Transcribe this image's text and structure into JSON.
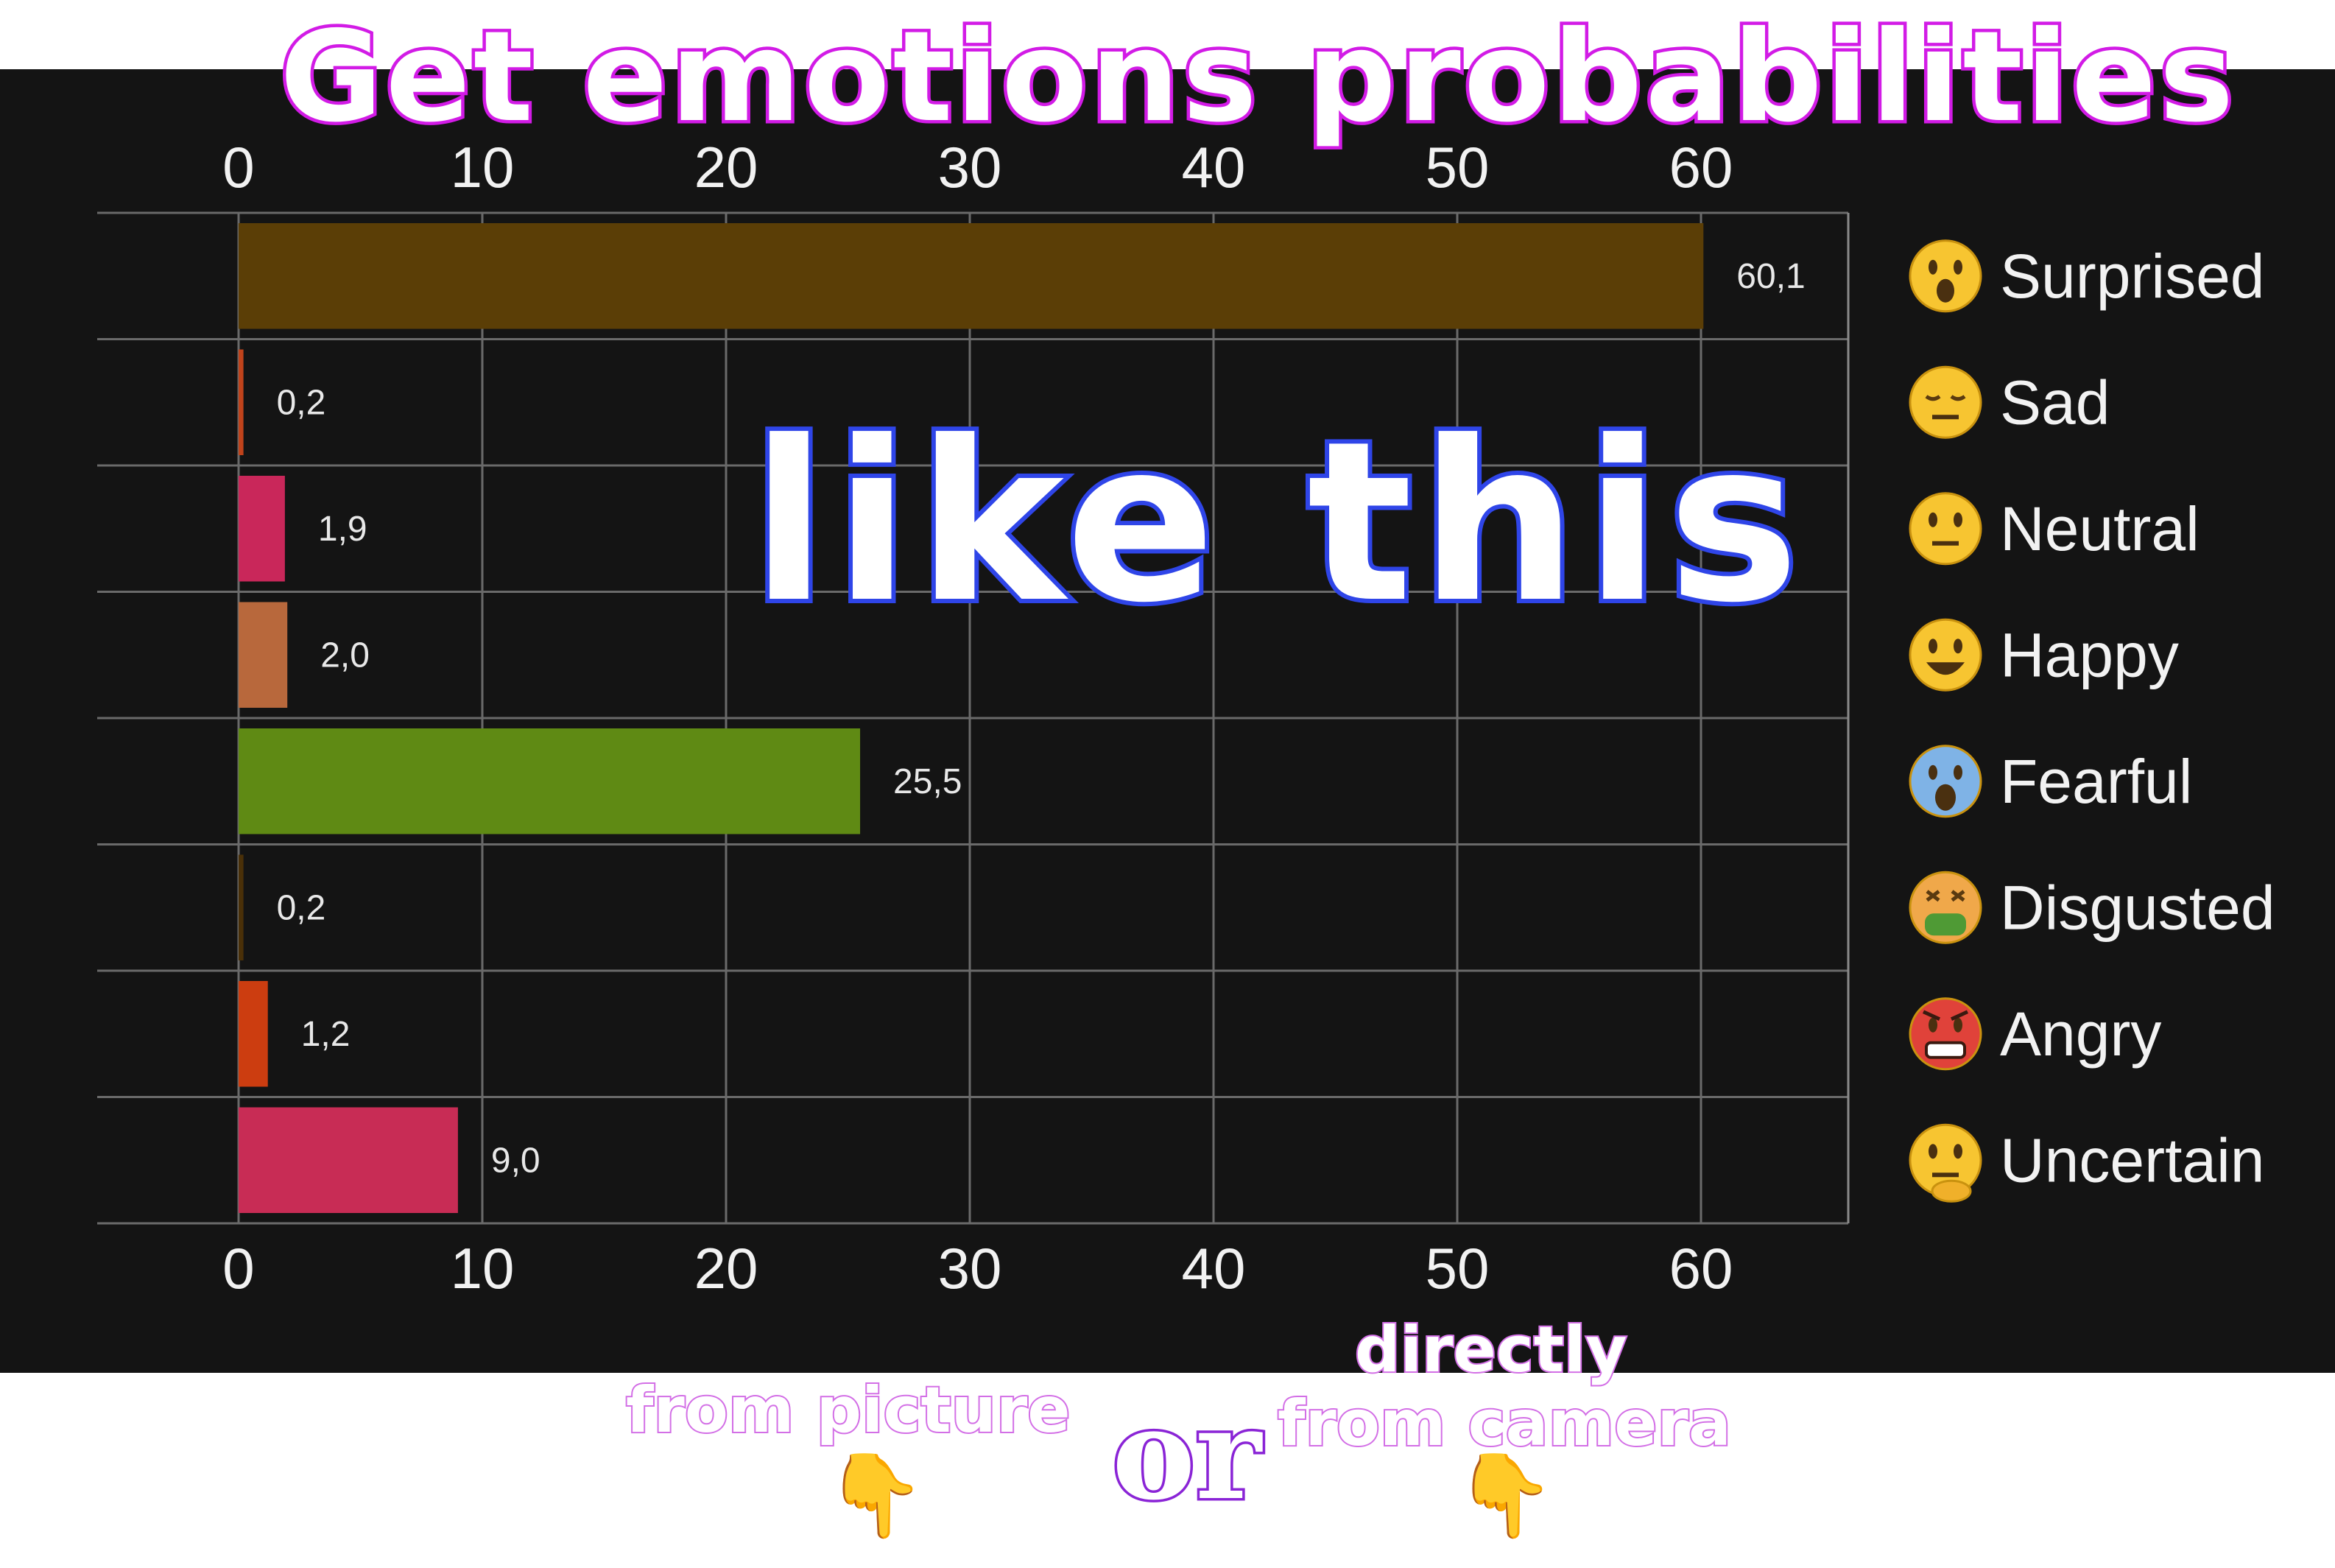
{
  "heading": "Get emotions probabilities",
  "overlay_text": "like this",
  "captions": {
    "from_picture": "from picture",
    "or": "or",
    "directly": "directly",
    "from_camera": "from camera",
    "hand_icon": "pointing-down-hand"
  },
  "colors": {
    "panel_bg": "#141414",
    "title_stroke": "#d21be6",
    "overlay_stroke": "#2f45e8",
    "caption_stroke": "#d36fe6"
  },
  "chart_data": {
    "type": "bar",
    "orientation": "horizontal",
    "categories": [
      "Surprised",
      "Sad",
      "Neutral",
      "Happy",
      "Fearful",
      "Disgusted",
      "Angry",
      "Uncertain"
    ],
    "values": [
      60.1,
      0.2,
      1.9,
      2.0,
      25.5,
      0.2,
      1.2,
      9.0
    ],
    "value_labels": [
      "60,1",
      "0,2",
      "1,9",
      "2,0",
      "25,5",
      "0,2",
      "1,2",
      "9,0"
    ],
    "colors": [
      "#5b3e06",
      "#c0431b",
      "#c9275a",
      "#b8683c",
      "#5f8a14",
      "#4a3008",
      "#cc3d10",
      "#c82c55"
    ],
    "legend_icons": [
      "astonished-face-icon",
      "pensive-face-icon",
      "neutral-face-icon",
      "grinning-face-icon",
      "fearful-face-icon",
      "nauseated-face-icon",
      "angry-face-icon",
      "thinking-face-icon"
    ],
    "xlim": [
      0,
      60
    ],
    "xticks": [
      0,
      10,
      20,
      30,
      40,
      50,
      60
    ],
    "grid": true,
    "legend_position": "right"
  }
}
